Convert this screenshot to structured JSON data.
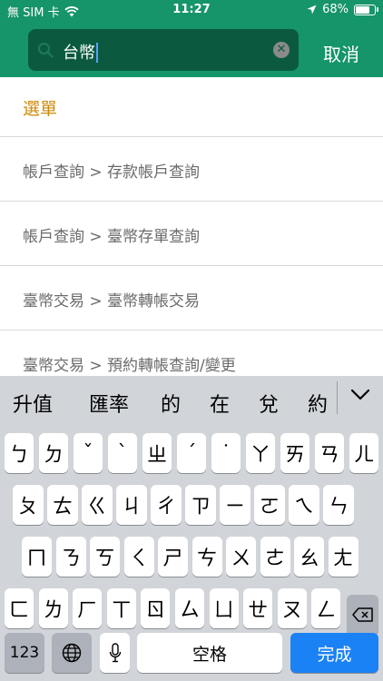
{
  "status_bar": {
    "carrier": "無 SIM 卡",
    "time": "11:27",
    "battery": "68%"
  },
  "search": {
    "value": "台幣",
    "cancel_label": "取消"
  },
  "section_title": "選單",
  "results": [
    "帳戶查詢 > 存款帳戶查詢",
    "帳戶查詢 > 臺幣存單查詢",
    "臺幣交易 > 臺幣轉帳交易",
    "臺幣交易 > 預約轉帳查詢/變更"
  ],
  "keyboard": {
    "candidates": [
      "升值",
      "匯率",
      "的",
      "在",
      "兌",
      "約"
    ],
    "row1": [
      "ㄅ",
      "ㄉ",
      "ˇ",
      "ˋ",
      "ㄓ",
      "ˊ",
      "˙",
      "ㄚ",
      "ㄞ",
      "ㄢ",
      "ㄦ"
    ],
    "row2": [
      "ㄆ",
      "ㄊ",
      "ㄍ",
      "ㄐ",
      "ㄔ",
      "ㄗ",
      "ㄧ",
      "ㄛ",
      "ㄟ",
      "ㄣ"
    ],
    "row3": [
      "ㄇ",
      "ㄋ",
      "ㄎ",
      "ㄑ",
      "ㄕ",
      "ㄘ",
      "ㄨ",
      "ㄜ",
      "ㄠ",
      "ㄤ"
    ],
    "row4": [
      "ㄈ",
      "ㄌ",
      "ㄏ",
      "ㄒ",
      "ㄖ",
      "ㄙ",
      "ㄩ",
      "ㄝ",
      "ㄡ",
      "ㄥ"
    ],
    "numbers_label": "123",
    "space_label": "空格",
    "done_label": "完成"
  },
  "colors": {
    "header": "#16946a",
    "search_field": "#0b5a40",
    "section_title": "#cc8a0c",
    "done_key": "#1b82f5"
  }
}
